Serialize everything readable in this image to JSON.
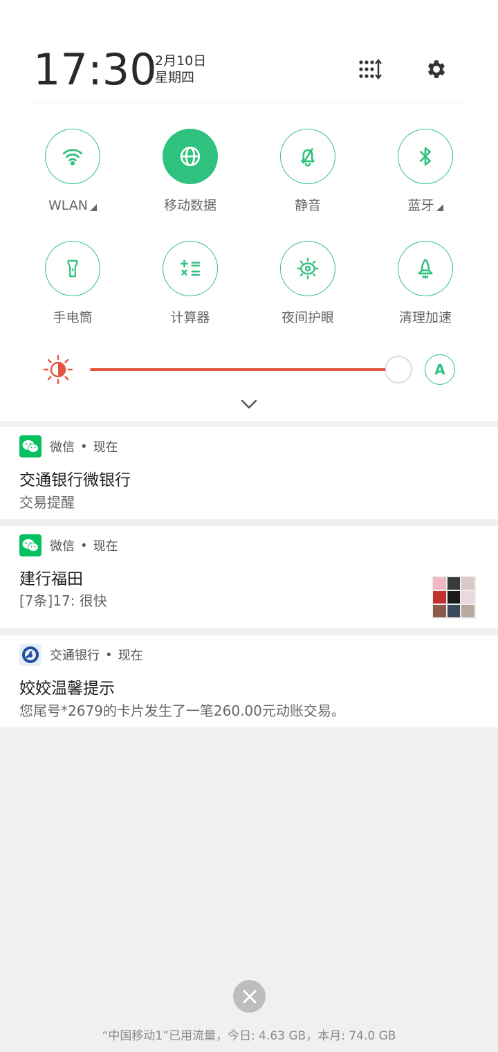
{
  "header": {
    "time": "17:30",
    "date": "2月10日",
    "weekday": "星期四",
    "edit_icon": "sort-grid-icon",
    "settings_icon": "gear-icon"
  },
  "tiles": [
    {
      "label": "WLAN",
      "icon": "wifi-icon",
      "active": false,
      "has_arrow": true
    },
    {
      "label": "移动数据",
      "icon": "globe-icon",
      "active": true,
      "has_arrow": false
    },
    {
      "label": "静音",
      "icon": "bell-off-icon",
      "active": false,
      "has_arrow": false
    },
    {
      "label": "蓝牙",
      "icon": "bluetooth-icon",
      "active": false,
      "has_arrow": true
    },
    {
      "label": "手电筒",
      "icon": "flashlight-icon",
      "active": false,
      "has_arrow": false
    },
    {
      "label": "计算器",
      "icon": "calculator-icon",
      "active": false,
      "has_arrow": false
    },
    {
      "label": "夜间护眼",
      "icon": "eye-care-icon",
      "active": false,
      "has_arrow": false
    },
    {
      "label": "清理加速",
      "icon": "rocket-icon",
      "active": false,
      "has_arrow": false
    }
  ],
  "brightness": {
    "level_fraction": 1.0,
    "auto_label": "A"
  },
  "notifications": [
    {
      "app": "微信",
      "sep": "•",
      "time": "现在",
      "title": "交通银行微银行",
      "body": "交易提醒"
    },
    {
      "app": "微信",
      "sep": "•",
      "time": "现在",
      "title": "建行福田",
      "body": "[7条]17: 很快"
    },
    {
      "app": "交通银行",
      "sep": "•",
      "time": "现在",
      "title": "姣姣温馨提示",
      "body": "您尾号*2679的卡片发生了一笔260.00元动账交易。"
    }
  ],
  "footer": {
    "data_usage": "“中国移动1”已用流量，今日: 4.63 GB，本月: 74.0 GB"
  },
  "colors": {
    "accent_green": "#2ec27e",
    "slider_red": "#e4533f",
    "wechat_green": "#07c160",
    "background": "#f0f0f0"
  }
}
